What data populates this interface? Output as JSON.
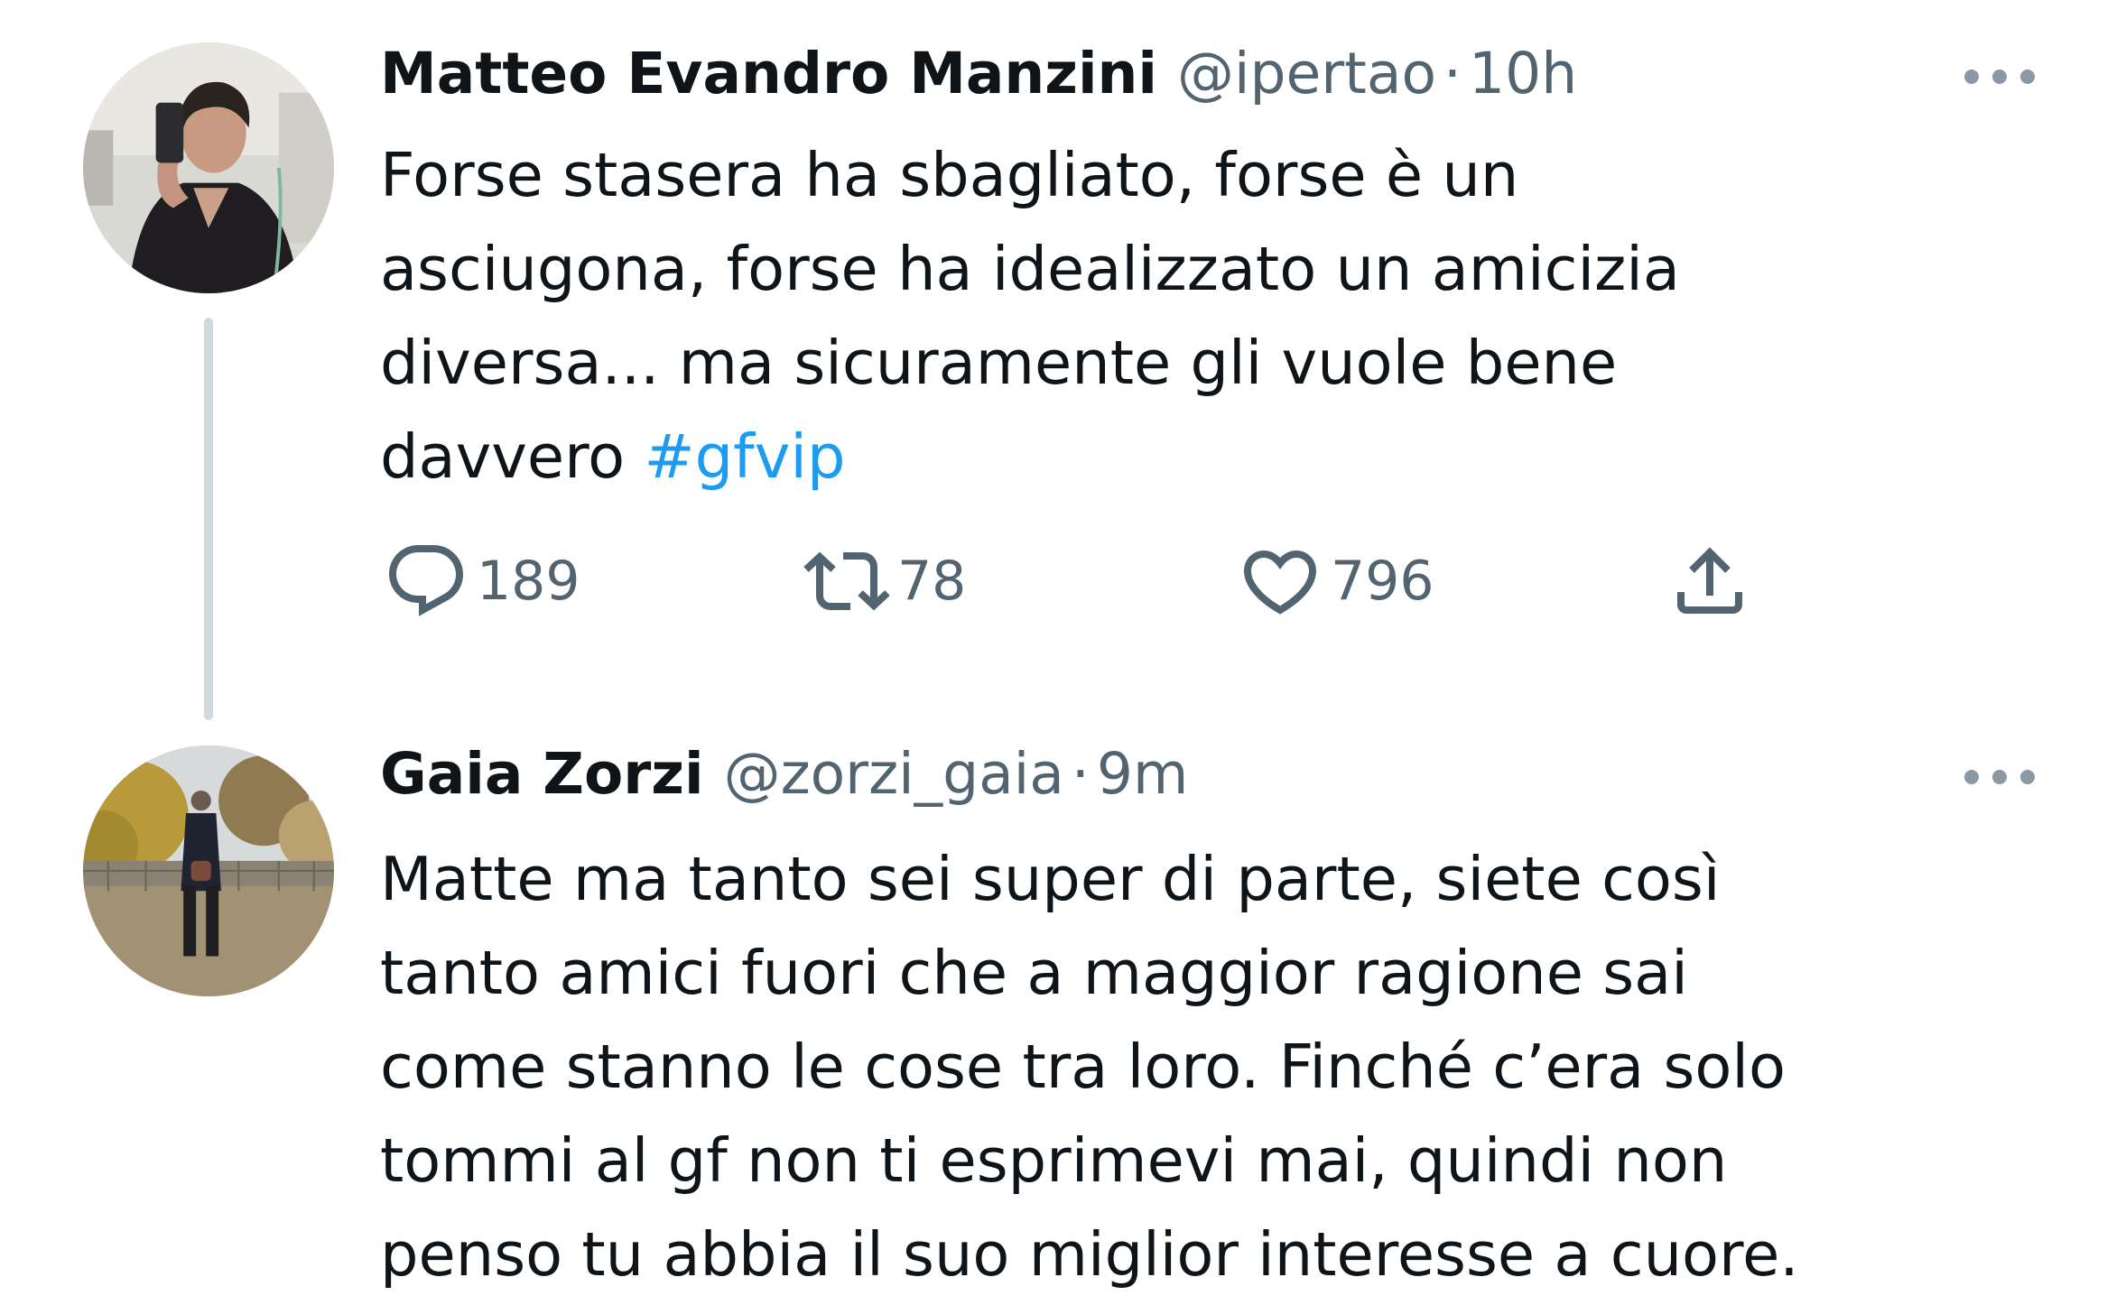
{
  "tweets": [
    {
      "name": "Matteo Evandro Manzini",
      "handle": "@ipertao",
      "separator": "·",
      "time": "10h",
      "text_lines": [
        "Forse stasera ha sbagliato, forse è un",
        "asciugona, forse ha idealizzato un amicizia",
        "diversa... ma sicuramente gli vuole bene",
        "davvero "
      ],
      "hashtag": "#gfvip",
      "replies": "189",
      "retweets": "78",
      "likes": "796"
    },
    {
      "name": "Gaia Zorzi",
      "handle": "@zorzi_gaia",
      "separator": "·",
      "time": "9m",
      "text_lines": [
        "Matte ma tanto sei super di parte, siete così",
        "tanto amici fuori che a maggior ragione sai",
        "come stanno le cose tra loro. Finché c’era solo",
        "tommi al gf non ti esprimevi mai, quindi non",
        "penso tu abbia il suo miglior interesse a cuore."
      ]
    }
  ],
  "icons": {
    "more": "more-options-icon",
    "reply": "reply-icon",
    "retweet": "retweet-icon",
    "like": "like-icon",
    "share": "share-icon"
  },
  "colors": {
    "text": "#0f1419",
    "secondary": "#536471",
    "hashtag": "#1d9bf0",
    "thread_line": "#cfd9de"
  }
}
